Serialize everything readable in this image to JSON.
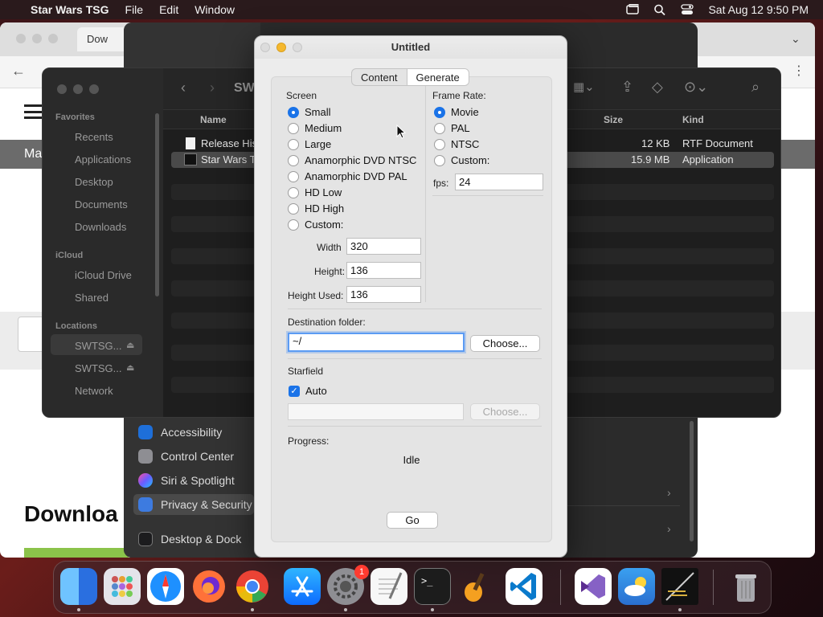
{
  "menubar": {
    "app_name": "Star Wars TSG",
    "items": [
      "File",
      "Edit",
      "Window"
    ],
    "clock": "Sat Aug 12  9:50 PM"
  },
  "browser": {
    "tab_label": "Dow",
    "site_bar_text": "Ma",
    "heading": "Downloa"
  },
  "settings": {
    "items": [
      {
        "label": "Accessibility",
        "color": "#1e6fd9"
      },
      {
        "label": "Control Center",
        "color": "#8e8e93"
      },
      {
        "label": "Siri & Spotlight",
        "color": "#b44ad9"
      },
      {
        "label": "Privacy & Security",
        "color": "#3d7be0"
      },
      {
        "label": "Desktop & Dock",
        "color": "#1c1c1e"
      }
    ]
  },
  "finder": {
    "path_label": "SW",
    "sidebar": {
      "favorites_header": "Favorites",
      "favorites": [
        "Recents",
        "Applications",
        "Desktop",
        "Documents",
        "Downloads"
      ],
      "icloud_header": "iCloud",
      "icloud": [
        "iCloud Drive",
        "Shared"
      ],
      "locations_header": "Locations",
      "locations": [
        "SWTSG...",
        "SWTSG...",
        "Network"
      ]
    },
    "columns": {
      "name": "Name",
      "size": "Size",
      "kind": "Kind"
    },
    "rows": [
      {
        "name": "Release His",
        "size": "12 KB",
        "kind": "RTF Document"
      },
      {
        "name": "Star Wars T",
        "size": "15.9 MB",
        "kind": "Application"
      }
    ]
  },
  "dialog": {
    "title": "Untitled",
    "tabs": [
      "Content",
      "Generate"
    ],
    "screen": {
      "label": "Screen",
      "options": [
        "Small",
        "Medium",
        "Large",
        "Anamorphic DVD NTSC",
        "Anamorphic DVD PAL",
        "HD Low",
        "HD High",
        "Custom:"
      ],
      "selected": "Small",
      "width_label": "Width",
      "width_value": "320",
      "height_label": "Height:",
      "height_value": "136",
      "height_used_label": "Height Used:",
      "height_used_value": "136"
    },
    "frame_rate": {
      "label": "Frame Rate:",
      "options": [
        "Movie",
        "PAL",
        "NTSC",
        "Custom:"
      ],
      "selected": "Movie",
      "fps_label": "fps:",
      "fps_value": "24"
    },
    "destination": {
      "label": "Destination folder:",
      "value": "~/",
      "choose_label": "Choose..."
    },
    "starfield": {
      "label": "Starfield",
      "auto_label": "Auto",
      "auto_checked": true,
      "value": "",
      "choose_label": "Choose..."
    },
    "progress": {
      "label": "Progress:",
      "status": "Idle"
    },
    "go_label": "Go"
  },
  "dock": {
    "apps": [
      {
        "name": "finder-icon",
        "color": "#2d8cf0"
      },
      {
        "name": "launchpad-icon",
        "color": "#d8d8dc"
      },
      {
        "name": "safari-icon",
        "color": "#1e90ff"
      },
      {
        "name": "firefox-icon",
        "color": "#ff7139"
      },
      {
        "name": "chrome-icon",
        "color": "#ffffff"
      },
      {
        "name": "app-store-icon",
        "color": "#0d84ff"
      },
      {
        "name": "system-settings-icon",
        "color": "#8e8e93"
      },
      {
        "name": "textedit-icon",
        "color": "#f5f5f5"
      },
      {
        "name": "terminal-icon",
        "color": "#1c1c1c"
      },
      {
        "name": "garageband-icon",
        "color": "#f4a020"
      },
      {
        "name": "vscode-icon",
        "color": "#ffffff"
      },
      {
        "name": "visual-studio-icon",
        "color": "#ffffff"
      },
      {
        "name": "weather-icon",
        "color": "#3a8ee6"
      },
      {
        "name": "star-wars-tsg-icon",
        "color": "#1a1a1a"
      },
      {
        "name": "trash-icon",
        "color": "#9a9a9a"
      }
    ],
    "settings_badge": "1"
  }
}
